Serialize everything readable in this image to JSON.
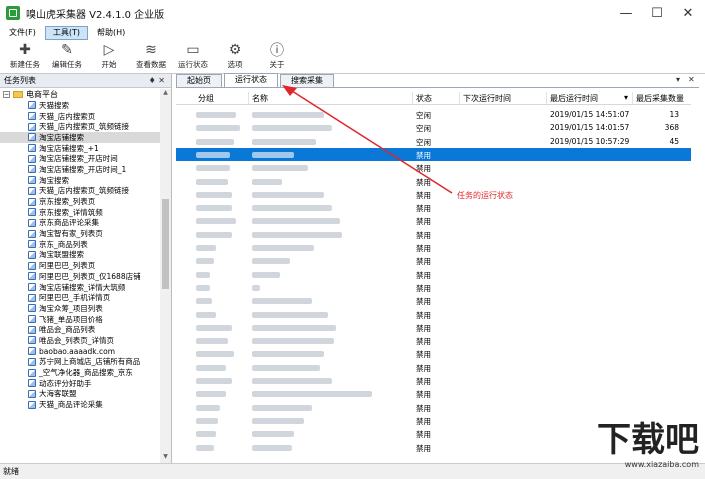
{
  "window": {
    "title": "嗅山虎采集器 V2.4.1.0 企业版",
    "minimize": "—",
    "maximize": "☐",
    "close": "✕"
  },
  "menu": [
    {
      "label": "文件(F)",
      "active": false
    },
    {
      "label": "工具(T)",
      "active": true
    },
    {
      "label": "帮助(H)",
      "active": false
    }
  ],
  "toolbar": [
    {
      "label": "新建任务",
      "icon": "✚",
      "name": "new-task"
    },
    {
      "label": "编辑任务",
      "icon": "✎",
      "name": "edit-task"
    },
    {
      "label": "开始",
      "icon": "▷",
      "name": "start"
    },
    {
      "label": "查看数据",
      "icon": "≋",
      "name": "view-data"
    },
    {
      "label": "运行状态",
      "icon": "▭",
      "name": "run-status"
    },
    {
      "label": "选项",
      "icon": "⚙",
      "name": "options"
    },
    {
      "label": "关于",
      "icon": "ⓘ",
      "name": "about"
    }
  ],
  "left_panel": {
    "title": "任务列表",
    "pin": "♦ ✕",
    "root": {
      "expander": "−",
      "label": "电商平台"
    },
    "items": [
      "天猫搜索",
      "天猫_店内搜索页",
      "天猫_店内搜索页_筑频链接",
      "淘宝店铺搜索",
      "淘宝店铺搜索_+1",
      "淘宝店铺搜索_开店时间",
      "淘宝店铺搜索_开店时间_1",
      "淘宝搜索",
      "天猫_店内搜索页_筑频链接",
      "京东搜索_列表页",
      "京东搜索_详情筑频",
      "京东商品评论采集",
      "淘宝智有家_列表页",
      "京东_商品列表",
      "淘宝联盟搜索",
      "阿里巴巴_列表页",
      "阿里巴巴_列表页_仅1688店铺",
      "淘宝店铺搜索_详情大筑频",
      "阿里巴巴_手机详情页",
      "淘宝众筹_项目列表",
      "飞猪_单品项目价格",
      "唯品会_商品列表",
      "唯品会_列表页_详情页",
      "baobao.aaaadk.com",
      "苏宁网上商城店_店铺所有商品",
      "_空气净化器_商品搜索_京东",
      "动态评分好助手",
      "大海客联盟",
      "天猫_商品评论采集"
    ],
    "selected_index": 3,
    "scroll_up": "▲",
    "scroll_down": "▼"
  },
  "tabs": [
    {
      "label": "起始页",
      "active": false
    },
    {
      "label": "运行状态",
      "active": true
    },
    {
      "label": "搜索采集",
      "active": false
    }
  ],
  "tab_controls": {
    "dropdown": "▾",
    "close": "✕"
  },
  "columns": [
    "分组",
    "名称",
    "状态",
    "下次运行时间",
    "最后运行时间",
    "最后采集数量"
  ],
  "rows": [
    {
      "group": "",
      "name": "",
      "status": "空闲",
      "next": "",
      "last": "2019/01/15 14:51:07",
      "count": "13",
      "gw": 40,
      "nw": 72
    },
    {
      "group": "",
      "name": "",
      "status": "空闲",
      "next": "",
      "last": "2019/01/15 14:01:57",
      "count": "368",
      "gw": 44,
      "nw": 80
    },
    {
      "group": "",
      "name": "",
      "status": "空闲",
      "next": "",
      "last": "2019/01/15 10:57:29",
      "count": "45",
      "gw": 38,
      "nw": 64
    },
    {
      "group": "",
      "name": "",
      "status": "禁用",
      "next": "",
      "last": "",
      "count": "",
      "gw": 34,
      "nw": 42,
      "selected": true
    },
    {
      "group": "",
      "name": "",
      "status": "禁用",
      "next": "",
      "last": "",
      "count": "",
      "gw": 34,
      "nw": 56
    },
    {
      "group": "",
      "name": "",
      "status": "禁用",
      "next": "",
      "last": "",
      "count": "",
      "gw": 32,
      "nw": 30
    },
    {
      "group": "",
      "name": "",
      "status": "禁用",
      "next": "",
      "last": "",
      "count": "",
      "gw": 36,
      "nw": 72
    },
    {
      "group": "",
      "name": "",
      "status": "禁用",
      "next": "",
      "last": "",
      "count": "",
      "gw": 36,
      "nw": 80
    },
    {
      "group": "",
      "name": "",
      "status": "禁用",
      "next": "",
      "last": "",
      "count": "",
      "gw": 40,
      "nw": 88
    },
    {
      "group": "",
      "name": "",
      "status": "禁用",
      "next": "",
      "last": "",
      "count": "",
      "gw": 36,
      "nw": 90
    },
    {
      "group": "",
      "name": "",
      "status": "禁用",
      "next": "",
      "last": "",
      "count": "",
      "gw": 20,
      "nw": 62
    },
    {
      "group": "",
      "name": "",
      "status": "禁用",
      "next": "",
      "last": "",
      "count": "",
      "gw": 18,
      "nw": 38
    },
    {
      "group": "",
      "name": "",
      "status": "禁用",
      "next": "",
      "last": "",
      "count": "",
      "gw": 14,
      "nw": 28
    },
    {
      "group": "",
      "name": "",
      "status": "禁用",
      "next": "",
      "last": "",
      "count": "",
      "gw": 14,
      "nw": 8
    },
    {
      "group": "",
      "name": "",
      "status": "禁用",
      "next": "",
      "last": "",
      "count": "",
      "gw": 16,
      "nw": 60
    },
    {
      "group": "",
      "name": "",
      "status": "禁用",
      "next": "",
      "last": "",
      "count": "",
      "gw": 20,
      "nw": 76
    },
    {
      "group": "",
      "name": "",
      "status": "禁用",
      "next": "",
      "last": "",
      "count": "",
      "gw": 36,
      "nw": 84
    },
    {
      "group": "",
      "name": "",
      "status": "禁用",
      "next": "",
      "last": "",
      "count": "",
      "gw": 32,
      "nw": 82
    },
    {
      "group": "",
      "name": "",
      "status": "禁用",
      "next": "",
      "last": "",
      "count": "",
      "gw": 38,
      "nw": 72
    },
    {
      "group": "",
      "name": "",
      "status": "禁用",
      "next": "",
      "last": "",
      "count": "",
      "gw": 30,
      "nw": 68
    },
    {
      "group": "",
      "name": "",
      "status": "禁用",
      "next": "",
      "last": "",
      "count": "",
      "gw": 36,
      "nw": 80
    },
    {
      "group": "",
      "name": "",
      "status": "禁用",
      "next": "",
      "last": "",
      "count": "",
      "gw": 30,
      "nw": 120
    },
    {
      "group": "",
      "name": "",
      "status": "禁用",
      "next": "",
      "last": "",
      "count": "",
      "gw": 24,
      "nw": 60
    },
    {
      "group": "",
      "name": "",
      "status": "禁用",
      "next": "",
      "last": "",
      "count": "",
      "gw": 22,
      "nw": 52
    },
    {
      "group": "",
      "name": "",
      "status": "禁用",
      "next": "",
      "last": "",
      "count": "",
      "gw": 20,
      "nw": 42
    },
    {
      "group": "",
      "name": "",
      "status": "禁用",
      "next": "",
      "last": "",
      "count": "",
      "gw": 18,
      "nw": 40
    }
  ],
  "annotation": {
    "label": "任务的运行状态",
    "color": "#e0262b"
  },
  "status_bar": "就绪",
  "watermark": {
    "logo": "下载吧",
    "url": "www.xiazaiba.com"
  }
}
